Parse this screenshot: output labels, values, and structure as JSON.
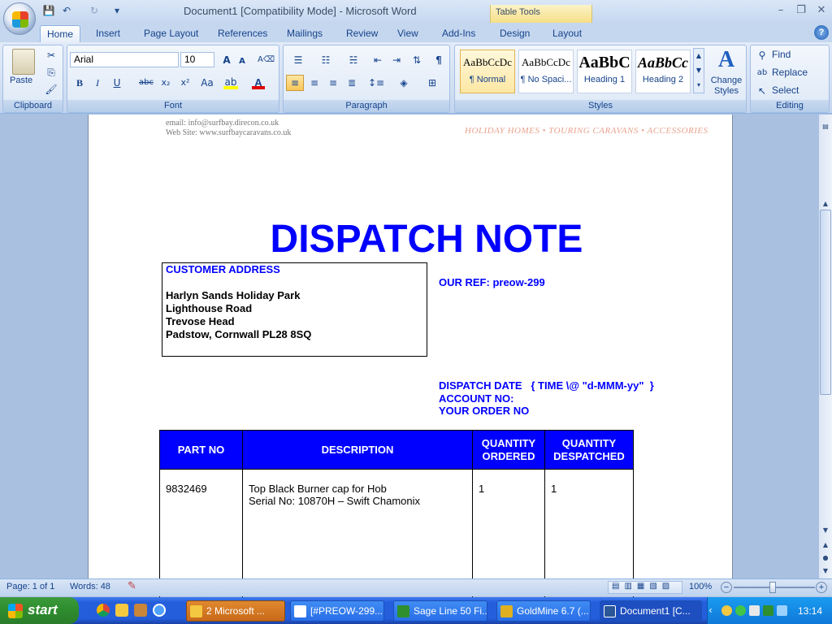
{
  "window": {
    "title": "Document1 [Compatibility Mode] - Microsoft Word",
    "context_tab_group": "Table Tools",
    "controls": {
      "minimize": "–",
      "restore": "❐",
      "close": "✕"
    }
  },
  "qat": {
    "save": "💾",
    "undo": "↶",
    "redo": "↻",
    "customize": "▾"
  },
  "tabs": [
    "Home",
    "Insert",
    "Page Layout",
    "References",
    "Mailings",
    "Review",
    "View",
    "Add-Ins",
    "Design",
    "Layout"
  ],
  "active_tab": "Home",
  "ribbon": {
    "clipboard": {
      "label": "Clipboard",
      "paste": "Paste"
    },
    "font": {
      "label": "Font",
      "name": "Arial",
      "size": "10",
      "bold": "B",
      "italic": "I",
      "underline": "U",
      "strike": "abc",
      "subscript": "x₂",
      "superscript": "x²",
      "change_case": "Aa",
      "grow": "A",
      "shrink": "A"
    },
    "paragraph": {
      "label": "Paragraph",
      "show_marks": "¶"
    },
    "styles": {
      "label": "Styles",
      "items": [
        {
          "sample": "AaBbCcDc",
          "name": "¶ Normal"
        },
        {
          "sample": "AaBbCcDc",
          "name": "¶ No Spaci..."
        },
        {
          "sample": "AaBbC",
          "name": "Heading 1"
        },
        {
          "sample": "AaBbCc",
          "name": "Heading 2"
        }
      ],
      "change_styles_line1": "Change",
      "change_styles_line2": "Styles"
    },
    "editing": {
      "label": "Editing",
      "find": "Find",
      "replace": "Replace",
      "select": "Select"
    }
  },
  "document": {
    "header_email": "email: info@surfbay.direcon.co.uk",
    "header_web": "Web Site: www.surfbaycaravans.co.uk",
    "header_tagline": "HOLIDAY HOMES • TOURING CARAVANS • ACCESSORIES",
    "title": "DISPATCH NOTE",
    "customer_address_heading": "CUSTOMER ADDRESS",
    "address_lines": [
      "Harlyn Sands Holiday Park",
      "Lighthouse Road",
      "Trevose Head",
      "Padstow, Cornwall PL28 8SQ"
    ],
    "our_ref": "OUR REF: preow-299",
    "dispatch_date": "DISPATCH DATE   { TIME \\@ \"d-MMM-yy\"  }",
    "account_no": "ACCOUNT  NO:",
    "your_order_no": "YOUR ORDER  NO",
    "table": {
      "headers": [
        "PART NO",
        "DESCRIPTION",
        "QUANTITY ORDERED",
        "QUANTITY DESPATCHED"
      ],
      "rows": [
        {
          "part_no": "9832469",
          "description_line1": "Top Black Burner  cap for Hob",
          "description_line2": "Serial No:  10870H  – Swift Chamonix",
          "qty_ordered": "1",
          "qty_despatched": "1"
        }
      ]
    }
  },
  "status": {
    "page": "Page: 1 of 1",
    "words": "Words: 48",
    "zoom": "100%"
  },
  "taskbar": {
    "start": "start",
    "tasks": [
      {
        "label": "2 Microsoft ...",
        "active": true
      },
      {
        "label": "[#PREOW-299...",
        "active": false
      },
      {
        "label": "Sage Line 50 Fi...",
        "active": false
      },
      {
        "label": "GoldMine 6.7 (...",
        "active": false
      },
      {
        "label": "Document1 [C...",
        "active": false
      }
    ],
    "clock": "13:14"
  },
  "colors": {
    "accent_blue": "#0000ff",
    "ribbon": "#d0def2",
    "taskbar": "#245edb",
    "start_green": "#2f8f2f"
  }
}
